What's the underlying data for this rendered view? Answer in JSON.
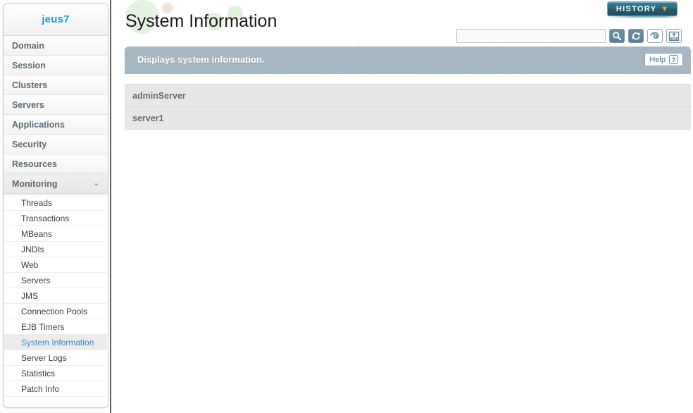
{
  "sidebar": {
    "brand": "jeus7",
    "top_items": [
      {
        "label": "Domain",
        "active": false,
        "chevron": ""
      },
      {
        "label": "Session",
        "active": false,
        "chevron": ""
      },
      {
        "label": "Clusters",
        "active": false,
        "chevron": ""
      },
      {
        "label": "Servers",
        "active": false,
        "chevron": ""
      },
      {
        "label": "Applications",
        "active": false,
        "chevron": ""
      },
      {
        "label": "Security",
        "active": false,
        "chevron": ""
      },
      {
        "label": "Resources",
        "active": false,
        "chevron": ""
      },
      {
        "label": "Monitoring",
        "active": true,
        "chevron": "⌄"
      }
    ],
    "submenu": [
      {
        "label": "Threads",
        "selected": false
      },
      {
        "label": "Transactions",
        "selected": false
      },
      {
        "label": "MBeans",
        "selected": false
      },
      {
        "label": "JNDIs",
        "selected": false
      },
      {
        "label": "Web",
        "selected": false
      },
      {
        "label": "Servers",
        "selected": false
      },
      {
        "label": "JMS",
        "selected": false
      },
      {
        "label": "Connection Pools",
        "selected": false
      },
      {
        "label": "EJB Timers",
        "selected": false
      },
      {
        "label": "System Information",
        "selected": true
      },
      {
        "label": "Server Logs",
        "selected": false
      },
      {
        "label": "Statistics",
        "selected": false
      },
      {
        "label": "Patch Info",
        "selected": false
      }
    ]
  },
  "header": {
    "title": "System Information",
    "history_label": "HISTORY",
    "history_chevron": "▼"
  },
  "toolbar": {
    "search_value": "",
    "search_placeholder": "",
    "buttons": [
      {
        "icon": "search-icon",
        "style": "dark"
      },
      {
        "icon": "refresh-icon",
        "style": "dark"
      },
      {
        "icon": "print-icon",
        "style": "light"
      },
      {
        "icon": "xml-export-icon",
        "style": "light"
      }
    ]
  },
  "info": {
    "text": "Displays system information.",
    "help_label": "Help",
    "help_icon": "?"
  },
  "servers": [
    {
      "name": "adminServer"
    },
    {
      "name": "server1"
    }
  ],
  "colors": {
    "brand_blue": "#2196dd",
    "info_bar": "#9fb0bd",
    "history_teal": "#2e6a80",
    "history_chevron_orange": "#f2a32c",
    "row_gray": "#e7e7e7",
    "selected_link": "#2f87c9"
  }
}
